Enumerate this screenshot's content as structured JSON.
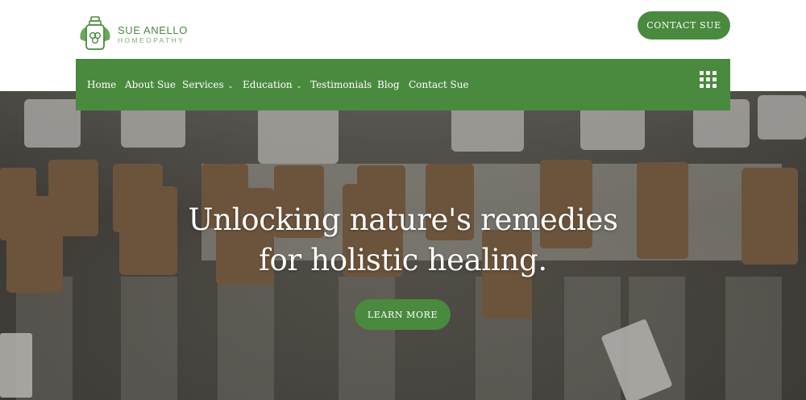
{
  "brand": {
    "name": "SUE ANELLO",
    "subtitle": "HOMEOPATHY",
    "accent_color": "#4a8a3f",
    "logo_icon": "bottle-leaf-logo"
  },
  "header": {
    "contact_button": "CONTACT SUE"
  },
  "nav": {
    "items": [
      {
        "label": "Home",
        "has_dropdown": false
      },
      {
        "label": "About Sue",
        "has_dropdown": false
      },
      {
        "label": "Services",
        "has_dropdown": true
      },
      {
        "label": "Education",
        "has_dropdown": true
      },
      {
        "label": "Testimonials",
        "has_dropdown": false
      },
      {
        "label": "Blog",
        "has_dropdown": false
      },
      {
        "label": "Contact Sue",
        "has_dropdown": false
      }
    ],
    "menu_icon": "grid-menu-icon"
  },
  "hero": {
    "headline_line1": "Unlocking nature's remedies",
    "headline_line2": "for holistic healing.",
    "cta_button": "LEARN MORE"
  }
}
